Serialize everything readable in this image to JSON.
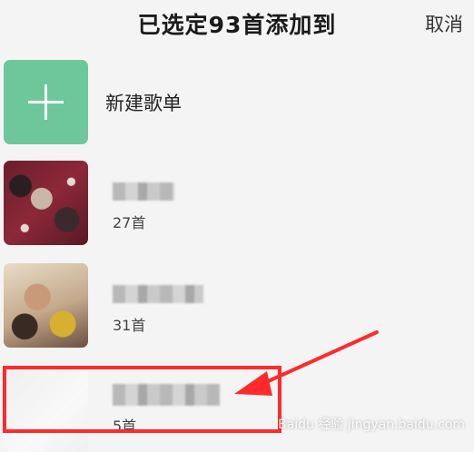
{
  "header": {
    "title": "已选定93首添加到",
    "cancel_label": "取消"
  },
  "new_playlist": {
    "label": "新建歌单"
  },
  "playlists": [
    {
      "count": "27首"
    },
    {
      "count": "31首"
    },
    {
      "count": "5首"
    }
  ],
  "watermark": "Baidu 经验 jingyan.baidu.com",
  "colors": {
    "accent_green": "#6dc79a",
    "highlight_red": "#ff2a2a"
  }
}
